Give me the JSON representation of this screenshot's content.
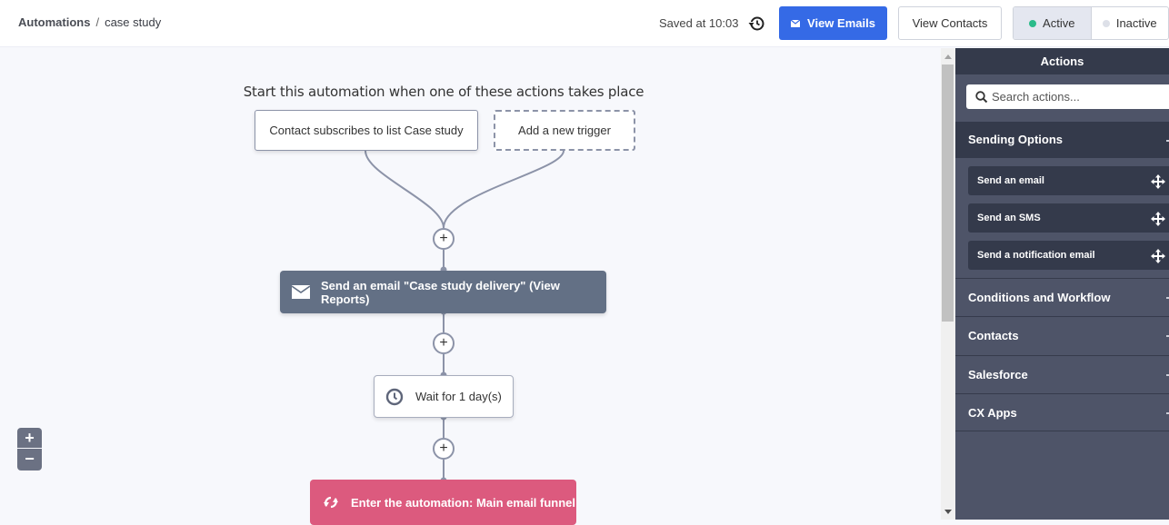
{
  "header": {
    "breadcrumb": {
      "root": "Automations",
      "separator": "/",
      "current": "case study"
    },
    "saved_status": "Saved at 10:03",
    "history_icon": "history-icon",
    "view_emails_label": "View Emails",
    "view_emails_icon": "envelope-icon",
    "view_contacts_label": "View Contacts",
    "status_toggle": {
      "options": [
        {
          "label": "Active",
          "dot_color": "#2bbb8a",
          "selected": true
        },
        {
          "label": "Inactive",
          "dot_color": "#dde0e8",
          "selected": false
        }
      ]
    }
  },
  "canvas": {
    "title": "Start this automation when one of these actions takes place",
    "triggers": [
      {
        "label": "Contact subscribes to list Case study"
      },
      {
        "label": "Add a new trigger"
      }
    ],
    "add_step_symbol": "+",
    "steps": [
      {
        "type": "send-email",
        "icon": "envelope-icon",
        "label": "Send an email \"Case study delivery\" (View Reports)",
        "color": "#637085"
      },
      {
        "type": "wait",
        "icon": "clock-icon",
        "label": "Wait for 1 day(s)"
      },
      {
        "type": "enter-automation",
        "icon": "sync-icon",
        "label": "Enter the automation: Main email funnel",
        "color": "#dc5a7e"
      }
    ],
    "zoom_controls": {
      "zoom_in": "+",
      "zoom_out": "−"
    }
  },
  "sidebar": {
    "title": "Actions",
    "search_placeholder": "Search actions...",
    "sections": [
      {
        "label": "Sending Options",
        "expanded": true,
        "items": [
          {
            "label": "Send an email"
          },
          {
            "label": "Send an SMS"
          },
          {
            "label": "Send a notification email"
          }
        ]
      },
      {
        "label": "Conditions and Workflow",
        "expanded": false
      },
      {
        "label": "Contacts",
        "expanded": false
      },
      {
        "label": "Salesforce",
        "expanded": false
      },
      {
        "label": "CX Apps",
        "expanded": false
      }
    ]
  },
  "colors": {
    "primary": "#356ae6",
    "sidebar_bg": "#4e5468",
    "sidebar_dark": "#343a4b",
    "connector": "#8c93a8"
  }
}
